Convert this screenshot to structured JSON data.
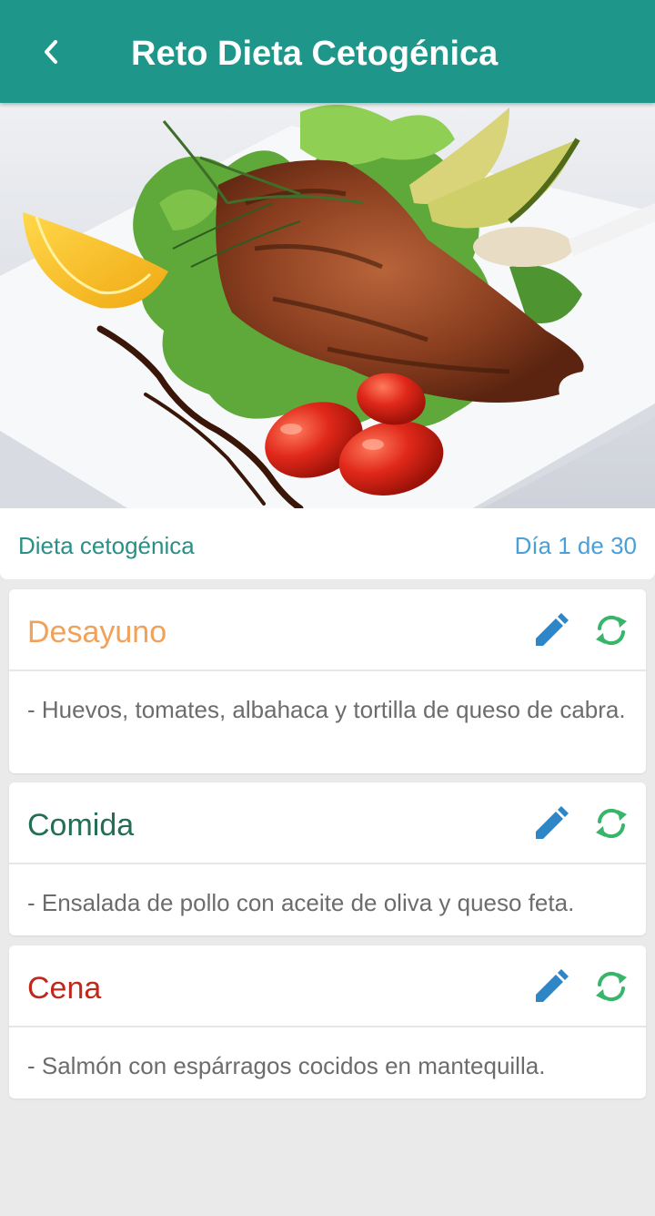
{
  "appbar": {
    "title": "Reto Dieta Cetogénica",
    "back_icon": "chevron-left-icon",
    "background": "#1f968a"
  },
  "hero": {
    "image": "grilled salmon steak with lettuce, lemon, avocado and cherry tomatoes"
  },
  "plan": {
    "name": "Dieta cetogénica",
    "day_counter": "Día 1 de 30"
  },
  "meals": [
    {
      "title": "Desayuno",
      "color": "#f0a25a",
      "description": "- Huevos, tomates, albahaca y tortilla de queso de cabra.",
      "edit_icon": "pencil-icon",
      "refresh_icon": "refresh-icon"
    },
    {
      "title": "Comida",
      "color": "#236e54",
      "description": "- Ensalada de pollo con aceite de oliva y queso feta.",
      "edit_icon": "pencil-icon",
      "refresh_icon": "refresh-icon"
    },
    {
      "title": "Cena",
      "color": "#c0281c",
      "description": "- Salmón con espárragos cocidos en mantequilla.",
      "edit_icon": "pencil-icon",
      "refresh_icon": "refresh-icon"
    }
  ],
  "colors": {
    "accent": "#1f968a",
    "edit_icon": "#2f86c6",
    "refresh_icon": "#38b56a",
    "background": "#eaeaea"
  }
}
